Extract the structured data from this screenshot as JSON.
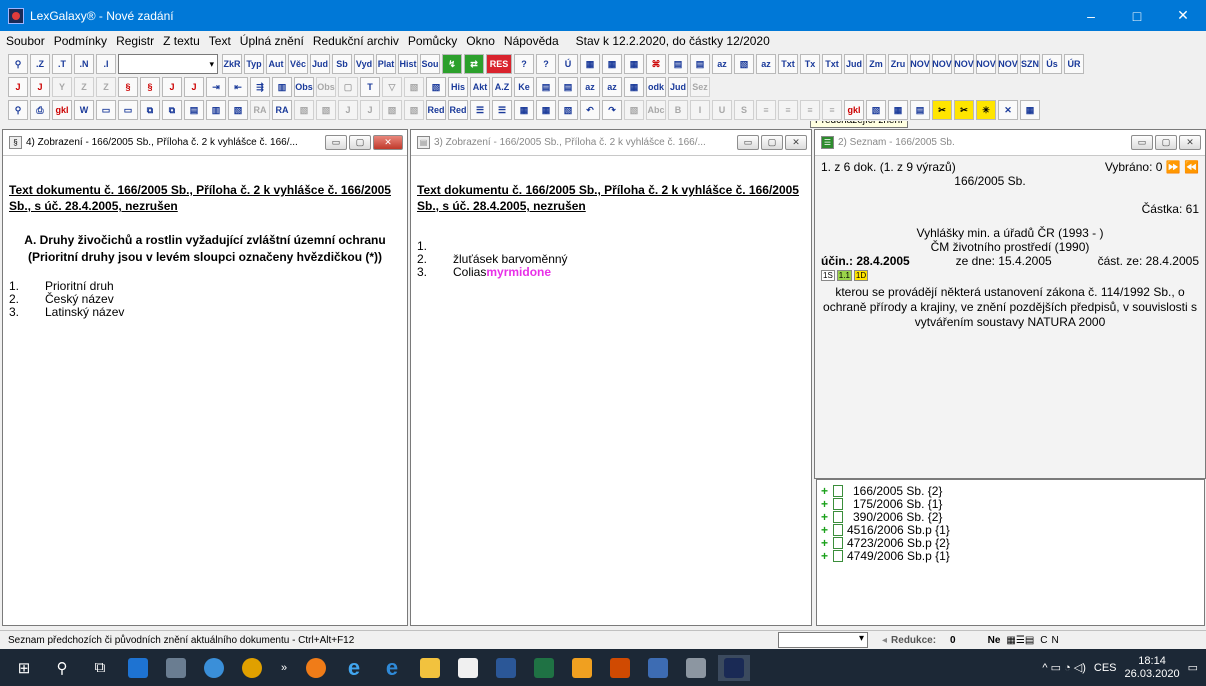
{
  "window": {
    "title": "LexGalaxy® - Nové zadání",
    "minimize": "–",
    "maximize": "□",
    "close": "✕"
  },
  "menu": {
    "items": [
      "Soubor",
      "Podmínky",
      "Registr",
      "Z textu",
      "Text",
      "Úplná znění",
      "Redukční archiv",
      "Pomůcky",
      "Okno",
      "Nápověda"
    ],
    "status": "Stav k 12.2.2020, do částky 12/2020"
  },
  "toolbar": {
    "tooltip": "Předcházející znění"
  },
  "panel_left": {
    "title": "4) Zobrazení - 166/2005 Sb., Příloha č. 2 k vyhlášce č. 166/...",
    "doc_link": "Text dokumentu č. 166/2005 Sb., Příloha č. 2 k vyhlášce č. 166/2005 Sb., s úč. 28.4.2005, nezrušen",
    "heading": "A. Druhy živočichů a rostlin vyžadující zvláštní územní ochranu (Prioritní druhy jsou v levém sloupci označeny hvězdičkou (*))",
    "items": [
      {
        "n": "1.",
        "t": "Prioritní druh"
      },
      {
        "n": "2.",
        "t": "Český název"
      },
      {
        "n": "3.",
        "t": "Latinský název"
      }
    ]
  },
  "panel_middle": {
    "title": "3) Zobrazení - 166/2005 Sb., Příloha č. 2 k vyhlášce č. 166/...",
    "doc_link": "Text dokumentu č. 166/2005 Sb., Příloha č. 2 k vyhlášce č. 166/2005 Sb., s úč. 28.4.2005, nezrušen",
    "items": [
      {
        "n": "1.",
        "t": ""
      },
      {
        "n": "2.",
        "t": "žluťásek barvoměnný"
      },
      {
        "n": "3.",
        "t": "Colias ",
        "t2": "myrmidone"
      }
    ]
  },
  "panel_right": {
    "title": "2) Seznam - 166/2005 Sb.",
    "count": "1. z 6 dok. (1. z 9 výrazů)",
    "selected": "Vybráno: 0",
    "doc_no": "166/2005 Sb.",
    "castka": "Částka: 61",
    "source1": "Vyhlášky min. a úřadů ČR (1993 -    )",
    "source2": "ČM životního prostředí (1990)",
    "ucin": "účin.: 28.4.2005",
    "ze_dne": "ze dne: 15.4.2005",
    "cast_ze": "část. ze: 28.4.2005",
    "badges": [
      "1S",
      "1.1",
      "1D"
    ],
    "description": "kterou se provádějí některá ustanovení zákona č. 114/1992 Sb., o ochraně přírody a krajiny, ve znění pozdějších předpisů, v souvislosti s vytvářením soustavy NATURA 2000",
    "tree": [
      "166/2005 Sb. {2}",
      "175/2006 Sb. {1}",
      "390/2006 Sb. {2}",
      "4516/2006 Sb.p {1}",
      "4723/2006 Sb.p {2}",
      "4749/2006 Sb.p {1}"
    ]
  },
  "status": {
    "text": "Seznam předchozích či původních znění aktuálního dokumentu - Ctrl+Alt+F12",
    "reduction_label": "Redukce:",
    "reduction_value": "0",
    "ne": "Ne",
    "c": "C",
    "n": "N"
  },
  "taskbar": {
    "time": "18:14",
    "date": "26.03.2020",
    "lang": "CES"
  }
}
